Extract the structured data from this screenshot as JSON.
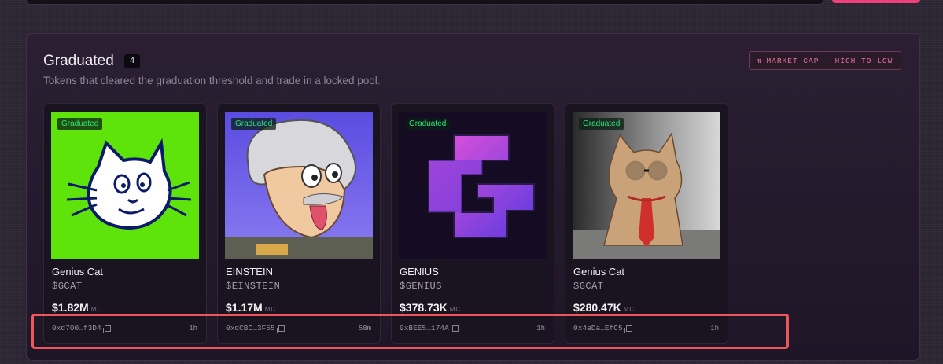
{
  "section": {
    "title": "Graduated",
    "count": "4",
    "subtitle": "Tokens that cleared the graduation threshold and trade in a locked pool.",
    "sort_label": "MARKET CAP · HIGH TO LOW",
    "sort_icon": "sort-arrows-icon"
  },
  "cards": [
    {
      "badge": "Graduated",
      "name": "Genius Cat",
      "ticker": "$GCAT",
      "market_cap": "$1.82M",
      "mc_label": "MC",
      "address": "0xd700…f3D4",
      "age": "1h"
    },
    {
      "badge": "Graduated",
      "name": "EINSTEIN",
      "ticker": "$EINSTEIN",
      "market_cap": "$1.17M",
      "mc_label": "MC",
      "address": "0xdCBC…3F55",
      "age": "58m"
    },
    {
      "badge": "Graduated",
      "name": "GENIUS",
      "ticker": "$GENIUS",
      "market_cap": "$378.73K",
      "mc_label": "MC",
      "address": "0xBEE5…174A",
      "age": "1h"
    },
    {
      "badge": "Graduated",
      "name": "Genius Cat",
      "ticker": "$GCAT",
      "market_cap": "$280.47K",
      "mc_label": "MC",
      "address": "0x4eDa…EfC5",
      "age": "1h"
    }
  ],
  "colors": {
    "accent": "#f0407a",
    "badge_text": "#2ee27a",
    "highlight": "#f0555a"
  }
}
